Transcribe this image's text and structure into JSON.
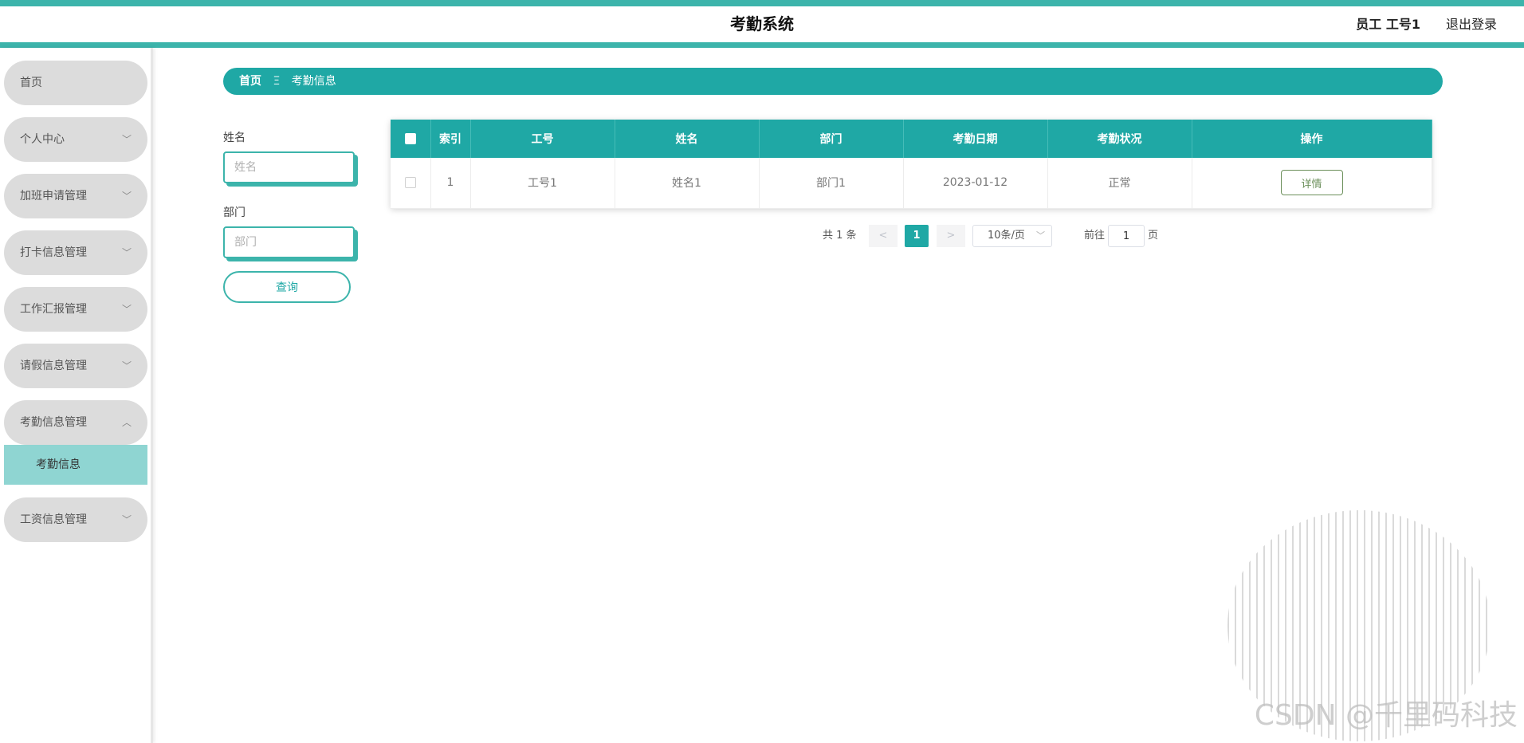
{
  "header": {
    "title": "考勤系统",
    "user_label": "员工 工号1",
    "logout_label": "退出登录"
  },
  "colors": {
    "accent": "#3cb4ab",
    "primary": "#1fa8a5",
    "menu_bg": "#dcdcdc",
    "submenu_active": "#8fd5d2"
  },
  "sidebar": {
    "items": [
      {
        "label": "首页",
        "icon": "none"
      },
      {
        "label": "个人中心",
        "icon": "chevron-down-icon"
      },
      {
        "label": "加班申请管理",
        "icon": "chevron-down-icon"
      },
      {
        "label": "打卡信息管理",
        "icon": "chevron-down-icon"
      },
      {
        "label": "工作汇报管理",
        "icon": "chevron-down-icon"
      },
      {
        "label": "请假信息管理",
        "icon": "chevron-down-icon"
      },
      {
        "label": "考勤信息管理",
        "icon": "chevron-up-icon"
      },
      {
        "label": "工资信息管理",
        "icon": "chevron-down-icon"
      }
    ],
    "active_submenu": {
      "label": "考勤信息"
    }
  },
  "breadcrumb": {
    "home": "首页",
    "separator": "Ξ",
    "current": "考勤信息"
  },
  "search": {
    "name_label": "姓名",
    "name_placeholder": "姓名",
    "dept_label": "部门",
    "dept_placeholder": "部门",
    "query_label": "查询"
  },
  "table": {
    "headers": [
      "索引",
      "工号",
      "姓名",
      "部门",
      "考勤日期",
      "考勤状况",
      "操作"
    ],
    "rows": [
      {
        "index": "1",
        "emp_no": "工号1",
        "name": "姓名1",
        "dept": "部门1",
        "date": "2023-01-12",
        "status": "正常",
        "action": "详情"
      }
    ]
  },
  "pagination": {
    "total_label": "共 1 条",
    "prev": "<",
    "current_page": "1",
    "next": ">",
    "page_size": "10条/页",
    "goto_label": "前往",
    "goto_value": "1",
    "goto_unit": "页"
  },
  "watermark": "CSDN @千里码科技"
}
